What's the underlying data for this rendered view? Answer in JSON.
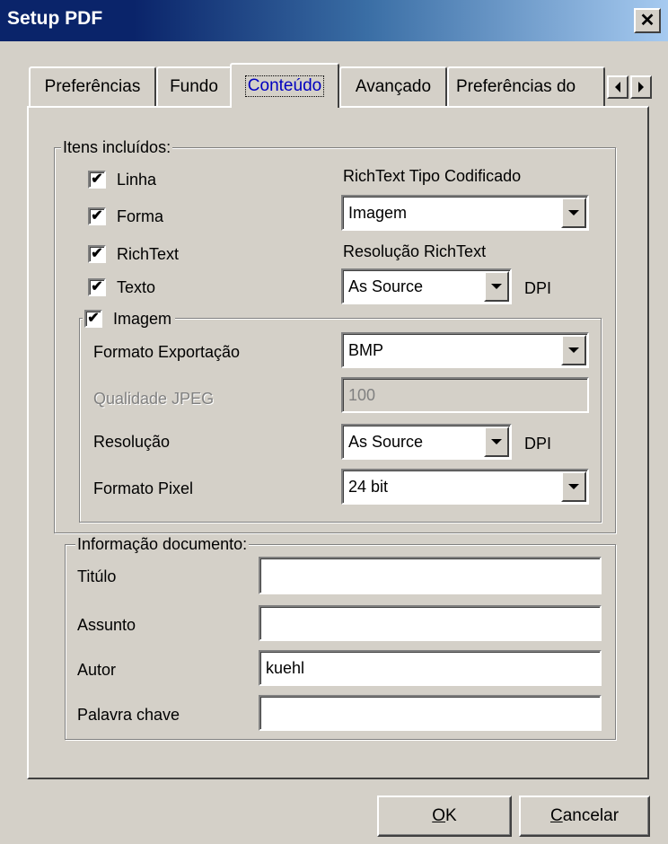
{
  "window": {
    "title": "Setup PDF",
    "close_glyph": "✕"
  },
  "tabs": [
    {
      "label": "Preferências"
    },
    {
      "label": "Fundo"
    },
    {
      "label": "Conteúdo"
    },
    {
      "label": "Avançado"
    },
    {
      "label": "Preferências do"
    }
  ],
  "tab_scroll": {
    "left_icon": "arrow-left-icon",
    "right_icon": "arrow-right-icon"
  },
  "included_items": {
    "legend": "Itens incluídos:",
    "checkboxes": [
      {
        "label": "Linha",
        "checked": true
      },
      {
        "label": "Forma",
        "checked": true
      },
      {
        "label": "RichText",
        "checked": true
      },
      {
        "label": "Texto",
        "checked": true
      }
    ],
    "richtext_encoding": {
      "label": "RichText Tipo Codificado",
      "value": "Imagem"
    },
    "richtext_resolution": {
      "label": "Resolução RichText",
      "value": "As Source",
      "unit": "DPI"
    }
  },
  "image_group": {
    "legend": "Imagem",
    "checked": true,
    "export_format": {
      "label": "Formato Exportação",
      "value": "BMP"
    },
    "jpeg_quality": {
      "label": "Qualidade JPEG",
      "value": "100",
      "disabled": true
    },
    "resolution": {
      "label": "Resolução",
      "value": "As Source",
      "unit": "DPI"
    },
    "pixel_format": {
      "label": "Formato Pixel",
      "value": "24 bit"
    }
  },
  "document_info": {
    "legend": "Informação documento:",
    "fields": [
      {
        "label": "Titúlo",
        "value": ""
      },
      {
        "label": "Assunto",
        "value": ""
      },
      {
        "label": "Autor",
        "value": "kuehl"
      },
      {
        "label": "Palavra chave",
        "value": ""
      }
    ]
  },
  "buttons": {
    "ok": {
      "mnemonic": "O",
      "rest": "K"
    },
    "cancel": {
      "mnemonic": "C",
      "rest": "ancelar"
    }
  },
  "check_glyph": "✔"
}
